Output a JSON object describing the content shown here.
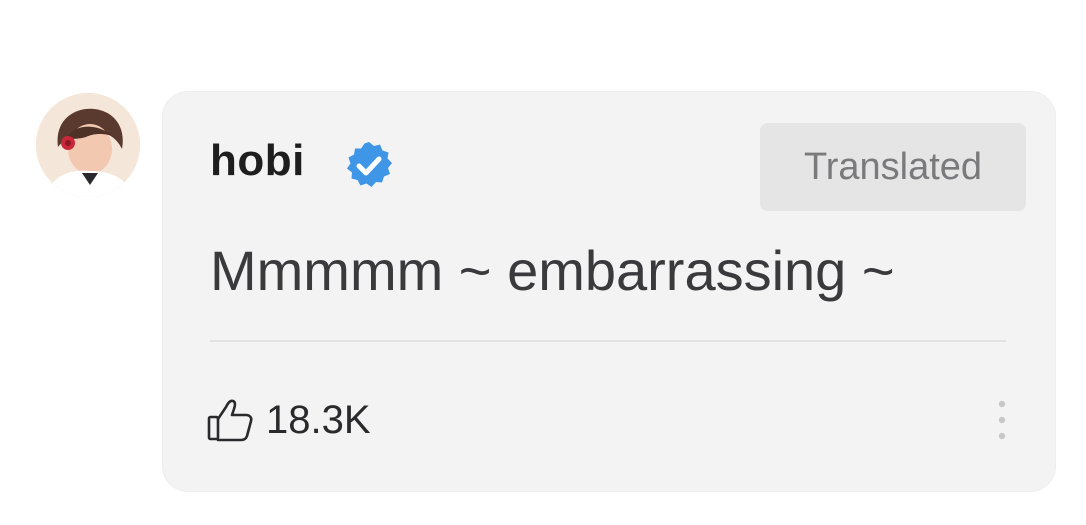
{
  "comment": {
    "author": {
      "name": "hobi",
      "verified": true,
      "avatar_icon": "avatar-photo"
    },
    "translated_label": "Translated",
    "text": "Mmmmm ~ embarrassing ~",
    "likes": {
      "icon": "thumbs-up-icon",
      "count": "18.3K"
    },
    "more_icon": "vertical-ellipsis-icon"
  },
  "colors": {
    "card_background": "#f3f3f4",
    "verified_badge": "#3f95e6",
    "translated_badge_bg": "#e5e5e6",
    "text_primary": "#1e1e1e",
    "text_secondary": "#7a7a7c"
  }
}
